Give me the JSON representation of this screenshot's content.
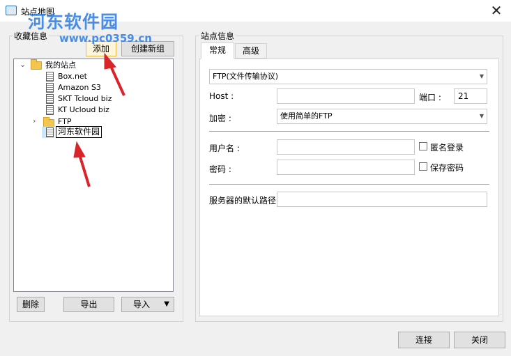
{
  "window": {
    "title": "站点地图",
    "close_glyph": "✕"
  },
  "watermark": {
    "line1": "河东软件园",
    "line2": "www.pc0359.cn"
  },
  "favorites": {
    "label": "收藏信息",
    "add_button": "添加",
    "new_group_button": "创建新组",
    "delete_button": "删除",
    "export_button": "导出",
    "import_button": "导入",
    "tree": {
      "root": "我的站点",
      "sites": [
        "Box.net",
        "Amazon S3",
        "SKT Tcloud biz",
        "KT Ucloud biz"
      ],
      "ftp_folder": "FTP",
      "editing_item": "河东软件园"
    }
  },
  "site_info": {
    "label": "站点信息",
    "tabs": [
      "常规",
      "高级"
    ],
    "active_tab": "常规",
    "protocol": "FTP(文件传输协议)",
    "host_label": "Host :",
    "host_value": "",
    "port_label": "端口 :",
    "port_value": "21",
    "encryption_label": "加密 :",
    "encryption_value": "使用简单的FTP",
    "username_label": "用户名 :",
    "username_value": "",
    "anonymous_label": "匿名登录",
    "password_label": "密码 :",
    "password_value": "",
    "save_password_label": "保存密码",
    "default_path_label": "服务器的默认路径",
    "default_path_value": ""
  },
  "footer": {
    "connect_button": "连接",
    "close_button": "关闭"
  },
  "colors": {
    "accent_arrow": "#d9252a",
    "highlight_border": "#e8b84a"
  }
}
